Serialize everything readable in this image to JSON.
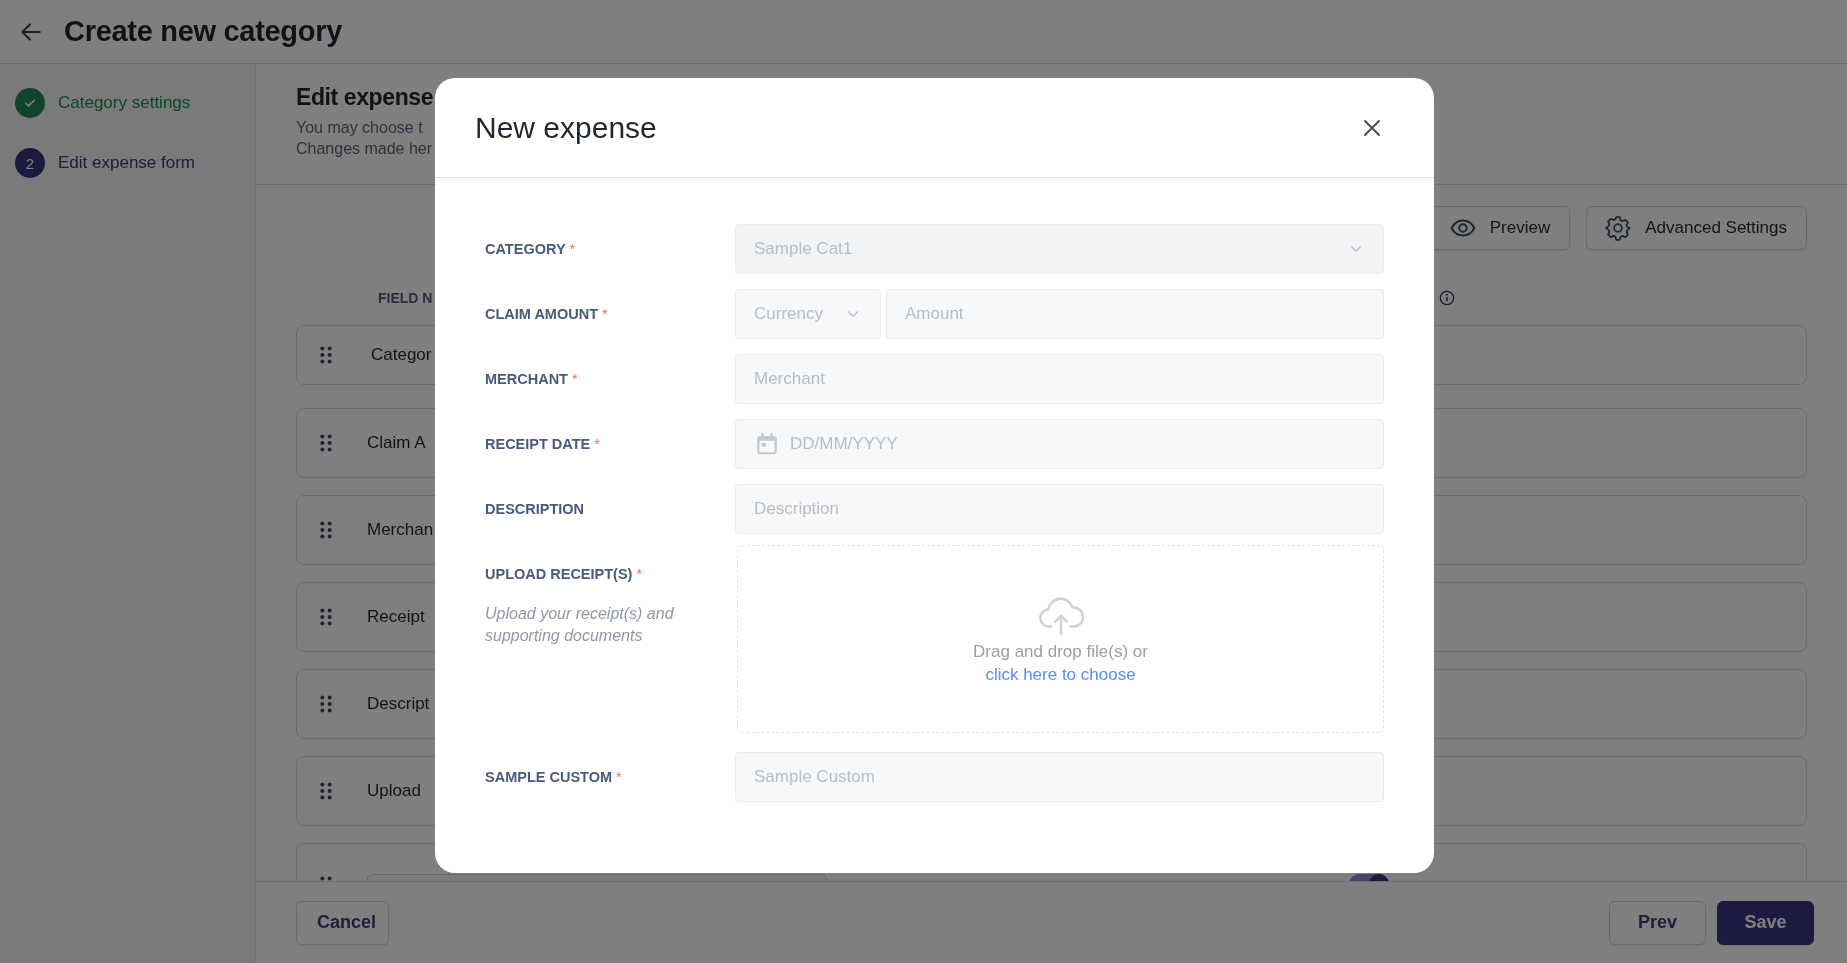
{
  "header": {
    "title": "Create new category"
  },
  "steps": [
    {
      "label": "Category settings",
      "completed": true
    },
    {
      "marker": "2",
      "label": "Edit expense form",
      "completed": false
    }
  ],
  "editor": {
    "heading": "Edit expense",
    "description_lines": [
      "You may choose t",
      "Changes made her"
    ],
    "buttons": [
      {
        "label": "Preview"
      },
      {
        "label": "Advanced Settings"
      }
    ],
    "column_header": "FIELD N",
    "rows": [
      {
        "name": "Categor",
        "kind": "field"
      },
      {
        "name": "Claim A",
        "kind": "field"
      },
      {
        "name": "Merchan",
        "kind": "field"
      },
      {
        "name": "Receipt",
        "kind": "field"
      },
      {
        "name": "Descript",
        "kind": "field"
      },
      {
        "name": "Upload",
        "kind": "field"
      },
      {
        "kind": "partial",
        "toggle_on": true
      }
    ]
  },
  "footer": {
    "cancel": "Cancel",
    "prev": "Prev",
    "save": "Save"
  },
  "modal": {
    "title": "New expense",
    "fields": [
      {
        "label": "CATEGORY",
        "mark": "*",
        "kind": "select",
        "value": "Sample Cat1",
        "disabled": true
      },
      {
        "label": "CLAIM AMOUNT",
        "mark": "*",
        "kind": "currency-amount",
        "currency_placeholder": "Currency",
        "placeholder": "Amount"
      },
      {
        "label": "MERCHANT",
        "mark": "*",
        "kind": "text",
        "placeholder": "Merchant"
      },
      {
        "label": "RECEIPT DATE",
        "mark": "*",
        "kind": "date",
        "placeholder": "DD/MM/YYYY"
      },
      {
        "label": "DESCRIPTION",
        "kind": "text",
        "placeholder": "Description"
      },
      {
        "label": "UPLOAD RECEIPT(S)",
        "mark": "*",
        "kind": "upload",
        "hint": "Upload your receipt(s) and supporting documents",
        "drop_text": "Drag and drop file(s) or",
        "link": "click here to choose"
      },
      {
        "label": "SAMPLE CUSTOM",
        "mark": "*",
        "kind": "text",
        "placeholder": "Sample Custom"
      }
    ]
  }
}
